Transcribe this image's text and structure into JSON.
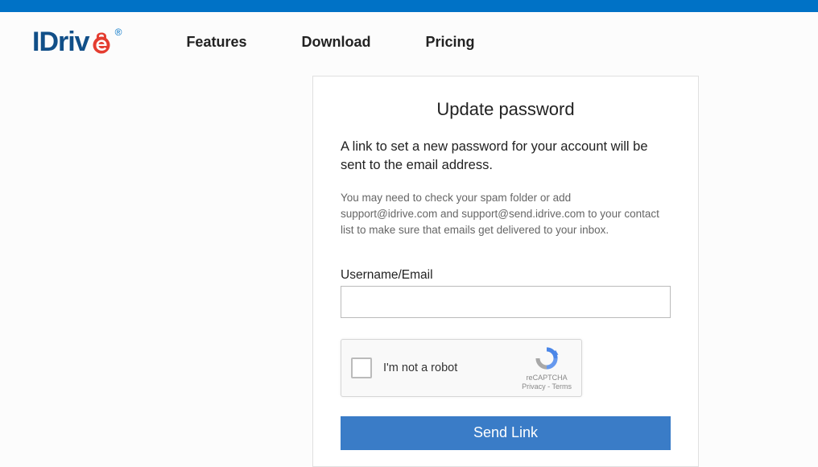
{
  "logo": {
    "text_prefix": "IDriv",
    "reg": "®"
  },
  "nav": {
    "features": "Features",
    "download": "Download",
    "pricing": "Pricing"
  },
  "card": {
    "title": "Update password",
    "description": "A link to set a new password for your account will be sent to the email address.",
    "note": "You may need to check your spam folder or add support@idrive.com and support@send.idrive.com to your contact list to make sure that emails get delivered to your inbox.",
    "field_label": "Username/Email",
    "input_value": "",
    "submit": "Send Link"
  },
  "recaptcha": {
    "label": "I'm not a robot",
    "brand": "reCAPTCHA",
    "privacy": "Privacy",
    "separator": " - ",
    "terms": "Terms"
  }
}
